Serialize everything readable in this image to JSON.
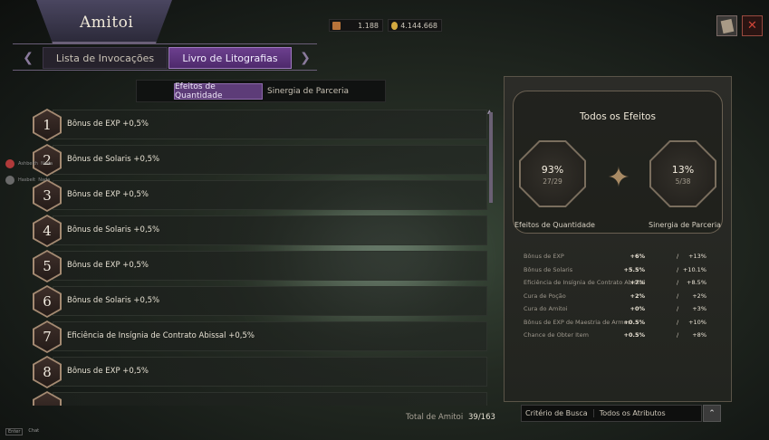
{
  "window": {
    "title": "Amitoi"
  },
  "currencies": [
    {
      "icon": "scroll-ticket-icon",
      "value": "1.188"
    },
    {
      "icon": "gold-coin-icon",
      "value": "4.144.668"
    }
  ],
  "top_buttons": [
    {
      "icon": "book-icon"
    },
    {
      "icon": "close-icon",
      "glyph": "✕"
    }
  ],
  "main_tabs": [
    {
      "label": "Lista de Invocações",
      "active": false
    },
    {
      "label": "Livro de Litografias",
      "active": true
    }
  ],
  "sub_tabs": [
    {
      "label": "Efeitos de Quantidade",
      "active": true
    },
    {
      "label": "Sinergia de Parceria",
      "active": false
    }
  ],
  "list_items": [
    {
      "number": "1",
      "text": "Bônus de EXP +0,5%"
    },
    {
      "number": "2",
      "text": "Bônus de Solaris +0,5%"
    },
    {
      "number": "3",
      "text": "Bônus de EXP +0,5%"
    },
    {
      "number": "4",
      "text": "Bônus de Solaris +0,5%"
    },
    {
      "number": "5",
      "text": "Bônus de EXP +0,5%"
    },
    {
      "number": "6",
      "text": "Bônus de Solaris +0,5%"
    },
    {
      "number": "7",
      "text": "Eficiência de Insígnia de Contrato Abissal +0,5%"
    },
    {
      "number": "8",
      "text": "Bônus de EXP +0,5%"
    },
    {
      "number": "",
      "text": ""
    }
  ],
  "chat_overlay": [
    {
      "name": "Ashbelth",
      "text": "Nada"
    },
    {
      "name": "Hasbelt",
      "text": "Nada"
    }
  ],
  "total": {
    "label": "Total de Amitoi",
    "value": "39/163"
  },
  "bottom_keys": [
    {
      "key": "Enter",
      "label": "Chat"
    }
  ],
  "effects_panel": {
    "title": "Todos os Efeitos",
    "quantity": {
      "percent": "93%",
      "fraction": "27/29",
      "label": "Efeitos de Quantidade"
    },
    "synergy": {
      "percent": "13%",
      "fraction": "5/38",
      "label": "Sinergia de Parceria"
    },
    "rows": [
      {
        "name": "Bônus de EXP",
        "quantity": "+6%",
        "synergy": "+13%"
      },
      {
        "name": "Bônus de Solaris",
        "quantity": "+5.5%",
        "synergy": "+10.1%"
      },
      {
        "name": "Eficiência de Insígnia de Contrato Abissal",
        "quantity": "+7%",
        "synergy": "+8.5%"
      },
      {
        "name": "Cura de Poção",
        "quantity": "+2%",
        "synergy": "+2%"
      },
      {
        "name": "Cura do Amitoi",
        "quantity": "+0%",
        "synergy": "+3%"
      },
      {
        "name": "Bônus de EXP de Maestria de Armas",
        "quantity": "+0.5%",
        "synergy": "+10%"
      },
      {
        "name": "Chance de Obter Item",
        "quantity": "+0.5%",
        "synergy": "+8%"
      }
    ]
  },
  "filter": {
    "label": "Critério de Busca",
    "value": "Todos os Atributos"
  },
  "colors": {
    "accent_purple": "#6c3f8e",
    "panel_border": "#5a5448",
    "close_red": "#c0392b"
  }
}
